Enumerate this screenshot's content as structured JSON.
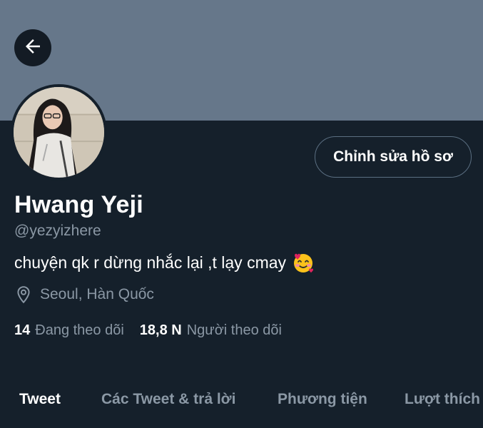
{
  "header": {
    "back_icon": "arrow-left-icon",
    "banner_color": "#66778a"
  },
  "profile": {
    "edit_button_label": "Chỉnh sửa hồ sơ",
    "display_name": "Hwang Yeji",
    "handle": "@yezyizhere",
    "bio": "chuyện qk r dừng nhắc lại ,t lạy cmay",
    "bio_emoji": "smiling-face-with-hearts-icon",
    "location_icon": "location-pin-icon",
    "location": "Seoul, Hàn Quốc"
  },
  "stats": {
    "following_count": "14",
    "following_label": "Đang theo dõi",
    "followers_count": "18,8 N",
    "followers_label": "Người theo dõi"
  },
  "tabs": [
    {
      "label": "Tweet",
      "active": true
    },
    {
      "label": "Các Tweet & trả lời",
      "active": false
    },
    {
      "label": "Phương tiện",
      "active": false
    },
    {
      "label": "Lượt thích",
      "active": false
    }
  ],
  "colors": {
    "background": "#15202b",
    "text_primary": "#ffffff",
    "text_secondary": "#8b98a5"
  }
}
